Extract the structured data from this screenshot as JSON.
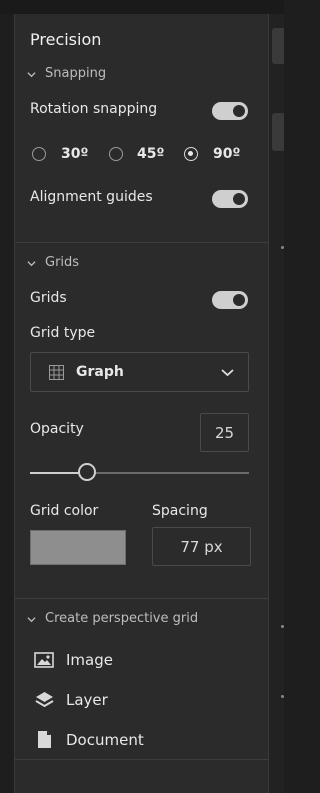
{
  "panel": {
    "title": "Precision",
    "snapping": {
      "header": "Snapping",
      "rotation_label": "Rotation snapping",
      "rotation_on": true,
      "angles": [
        {
          "label": "30º",
          "selected": false
        },
        {
          "label": "45º",
          "selected": false
        },
        {
          "label": "90º",
          "selected": true
        }
      ],
      "alignment_label": "Alignment guides",
      "alignment_on": true
    },
    "grids": {
      "header": "Grids",
      "toggle_label": "Grids",
      "toggle_on": true,
      "type_label": "Grid type",
      "type_value": "Graph",
      "opacity_label": "Opacity",
      "opacity_value": "25",
      "opacity_level": 0.25,
      "color_label": "Grid color",
      "color_value": "#8e8e8e",
      "spacing_label": "Spacing",
      "spacing_value": "77 px"
    },
    "perspective": {
      "header": "Create perspective grid",
      "items": [
        {
          "label": "Image",
          "icon": "image-icon"
        },
        {
          "label": "Layer",
          "icon": "layers-icon"
        },
        {
          "label": "Document",
          "icon": "document-icon"
        }
      ]
    }
  }
}
